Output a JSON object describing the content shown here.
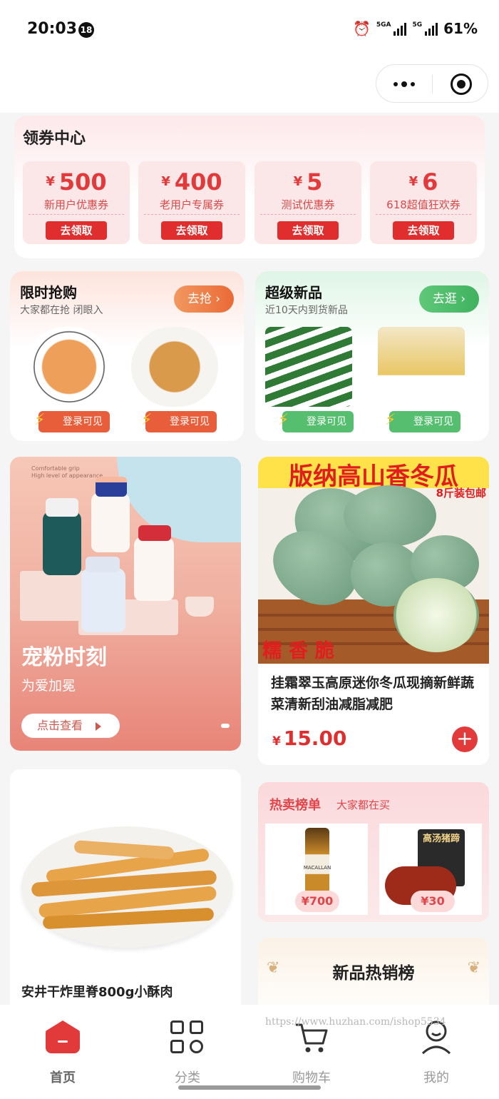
{
  "status_bar": {
    "time": "20:03",
    "badge": "18",
    "net1": "5GA",
    "net2": "5G",
    "battery": "61%"
  },
  "coupon_center": {
    "title": "领券中心",
    "currency": "¥",
    "coupons": [
      {
        "amount": "500",
        "name": "新用户优惠券",
        "button": "去领取"
      },
      {
        "amount": "400",
        "name": "老用户专属券",
        "button": "去领取"
      },
      {
        "amount": "5",
        "name": "测试优惠券",
        "button": "去领取"
      },
      {
        "amount": "6",
        "name": "618超值狂欢券",
        "button": "去领取"
      }
    ]
  },
  "flash_sale": {
    "title": "限时抢购",
    "subtitle": "大家都在抢 闭眼入",
    "button": "去抢 ›",
    "item_label": "登录可见"
  },
  "new_products": {
    "title": "超级新品",
    "subtitle": "近10天内到货新品",
    "button": "去逛 ›",
    "item_label": "登录可见"
  },
  "banner": {
    "title": "宠粉时刻",
    "subtitle": "为爱加冕",
    "button": "点击查看",
    "tiny_text": "Comfortable grip\nHigh level of appearance"
  },
  "product": {
    "image_headline": "版纳高山香冬瓜",
    "image_sub": "8斤装包邮",
    "image_tag": "糯香脆",
    "name": "挂霜翠玉高原迷你冬瓜现摘新鲜蔬菜清新刮油减脂减肥",
    "currency": "¥",
    "price": "15.00",
    "add_symbol": "+"
  },
  "food_card": {
    "name": "安井干炸里脊800g小酥肉"
  },
  "hot_list": {
    "title": "热卖榜单",
    "subtitle": "大家都在买",
    "items": [
      {
        "price": "¥700"
      },
      {
        "price": "¥30"
      }
    ],
    "tags": {
      "bottle": "MACALLAN",
      "box_brand": "高汤猪蹄"
    }
  },
  "new_hot": {
    "title": "新品热销榜"
  },
  "watermark": "https://www.huzhan.com/ishop5534",
  "tabbar": [
    {
      "label": "首页",
      "icon": "home-icon",
      "active": true
    },
    {
      "label": "分类",
      "icon": "category-icon",
      "active": false
    },
    {
      "label": "购物车",
      "icon": "cart-icon",
      "active": false
    },
    {
      "label": "我的",
      "icon": "profile-icon",
      "active": false
    }
  ],
  "colors": {
    "accent": "#e23a3a",
    "green": "#55bf6f",
    "orange": "#ea6a36"
  }
}
